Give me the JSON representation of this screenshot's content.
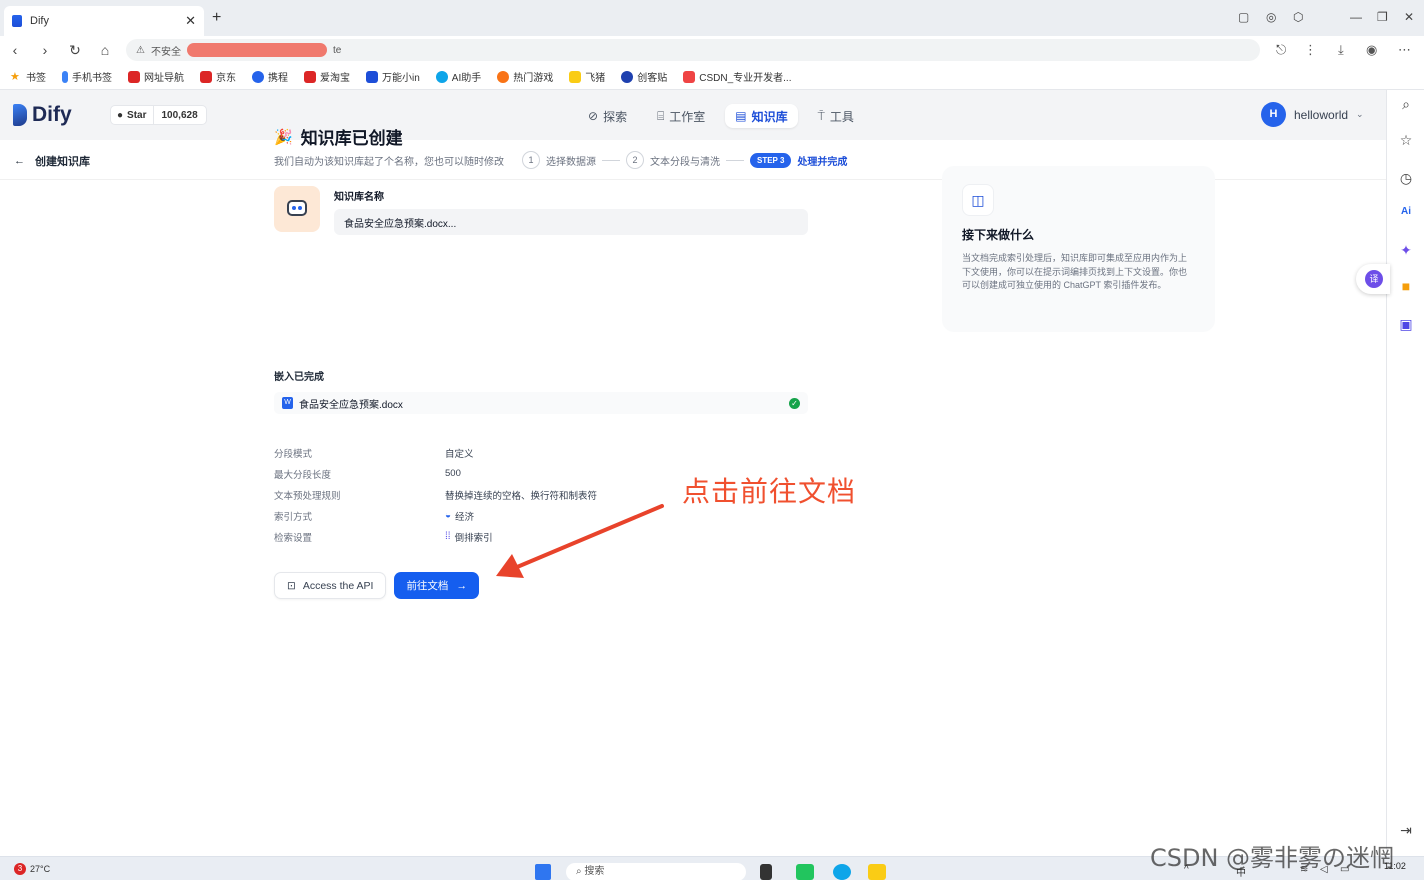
{
  "browser": {
    "tab_title": "Dify",
    "address_prefix": "不安全",
    "address_suffix": "te",
    "bookmarks": [
      "书签",
      "手机书签",
      "网址导航",
      "京东",
      "携程",
      "爱淘宝",
      "万能小in",
      "AI助手",
      "热门游戏",
      "飞猪",
      "创客贴",
      "CSDN_专业开发者..."
    ]
  },
  "header": {
    "logo": "Dify",
    "github_label": "Star",
    "github_count": "100,628",
    "nav": [
      "探索",
      "工作室",
      "知识库",
      "工具"
    ],
    "user": "helloworld",
    "avatar_letter": "H"
  },
  "subheader": {
    "back_label": "创建知识库",
    "step1_num": "1",
    "step1_label": "选择数据源",
    "step2_num": "2",
    "step2_label": "文本分段与清洗",
    "step3_pill": "STEP 3",
    "step3_label": "处理并完成"
  },
  "main": {
    "title": "知识库已创建",
    "subtitle": "我们自动为该知识库起了个名称，您也可以随时修改",
    "name_label": "知识库名称",
    "name_value": "食品安全应急预案.docx...",
    "embed_label": "嵌入已完成",
    "embed_file": "食品安全应急预案.docx",
    "info": [
      {
        "k": "分段模式",
        "v": "自定义"
      },
      {
        "k": "最大分段长度",
        "v": "500"
      },
      {
        "k": "文本预处理规则",
        "v": "替换掉连续的空格、换行符和制表符"
      },
      {
        "k": "索引方式",
        "v": "经济"
      },
      {
        "k": "检索设置",
        "v": "倒排索引"
      }
    ],
    "api_button": "Access the API",
    "doc_button": "前往文档"
  },
  "next_card": {
    "title": "接下来做什么",
    "text": "当文档完成索引处理后，知识库即可集成至应用内作为上下文使用，你可以在提示词编排页找到上下文设置。你也可以创建成可独立使用的 ChatGPT 索引插件发布。"
  },
  "annotation": "点击前往文档",
  "taskbar": {
    "weather_badge": "3",
    "temp": "27°C",
    "search": "搜索",
    "time": "11:02"
  },
  "watermark": "CSDN @雾非雾の迷惘",
  "colors": {
    "accent": "#155eef",
    "annotation": "#f0502f"
  }
}
